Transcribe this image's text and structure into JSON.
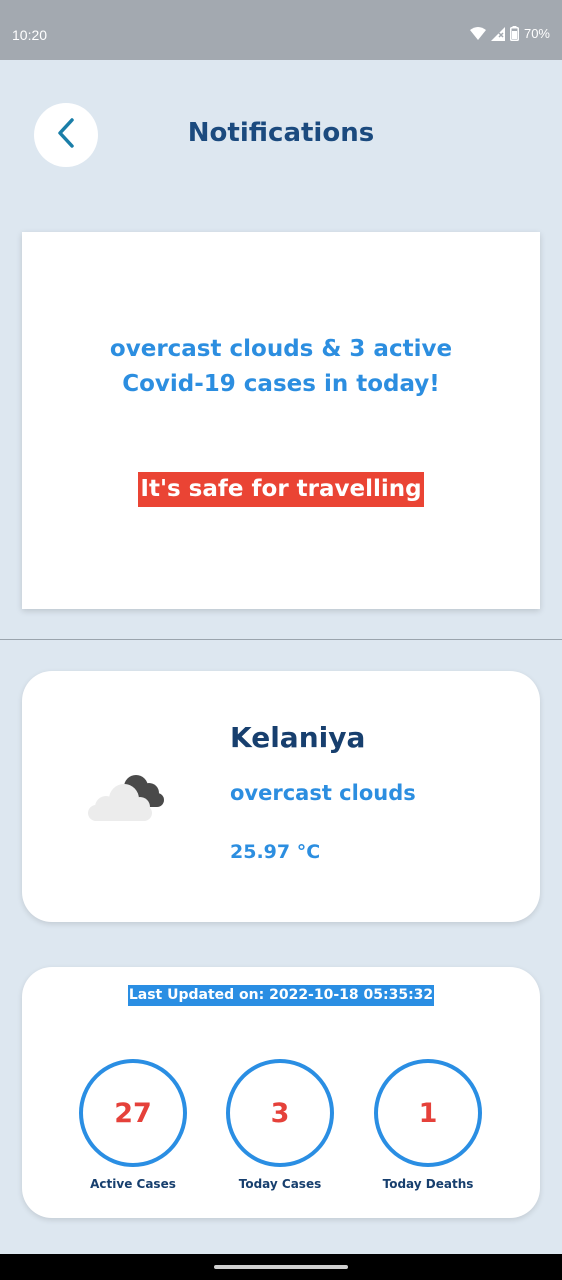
{
  "status_bar": {
    "time": "10:20",
    "battery": "70%",
    "icons": [
      "wifi-icon",
      "cell-signal-icon",
      "battery-icon"
    ]
  },
  "header": {
    "title": "Notifications",
    "back_icon": "chevron-left-icon"
  },
  "notification": {
    "message_line1": "overcast clouds & 3 active",
    "message_line2": "Covid-19 cases in today!",
    "safety_status": "It's safe for travelling"
  },
  "weather": {
    "city": "Kelaniya",
    "description": "overcast clouds",
    "temperature": "25.97 °C",
    "icon": "overcast-clouds-icon"
  },
  "covid": {
    "last_updated": "Last Updated on: 2022-10-18 05:35:32",
    "stats": [
      {
        "value": "27",
        "label": "Active Cases"
      },
      {
        "value": "3",
        "label": "Today Cases"
      },
      {
        "value": "1",
        "label": "Today Deaths"
      }
    ]
  },
  "colors": {
    "background": "#dde7f0",
    "title": "#1b4a7e",
    "accent_blue": "#2c8ee0",
    "alert_red": "#ea4434",
    "card": "#ffffff"
  }
}
